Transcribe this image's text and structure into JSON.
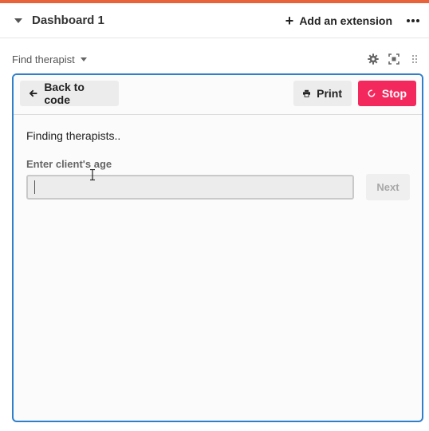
{
  "dashboard": {
    "title": "Dashboard 1",
    "add_extension_label": "Add an extension"
  },
  "extension": {
    "name": "Find therapist"
  },
  "toolbar": {
    "back_label": "Back to code",
    "print_label": "Print",
    "stop_label": "Stop"
  },
  "app": {
    "status_text": "Finding therapists..",
    "age_label": "Enter client's age",
    "age_value": "",
    "next_label": "Next"
  },
  "colors": {
    "accent_top": "#e8623a",
    "frame_border": "#2f7fcb",
    "stop_button": "#f3295e"
  },
  "icons": [
    "chevron-down-icon",
    "plus-icon",
    "more-icon",
    "gear-icon",
    "fullscreen-icon",
    "drag-handle-icon",
    "arrow-left-icon",
    "printer-icon",
    "spinner-icon",
    "text-cursor-icon"
  ]
}
